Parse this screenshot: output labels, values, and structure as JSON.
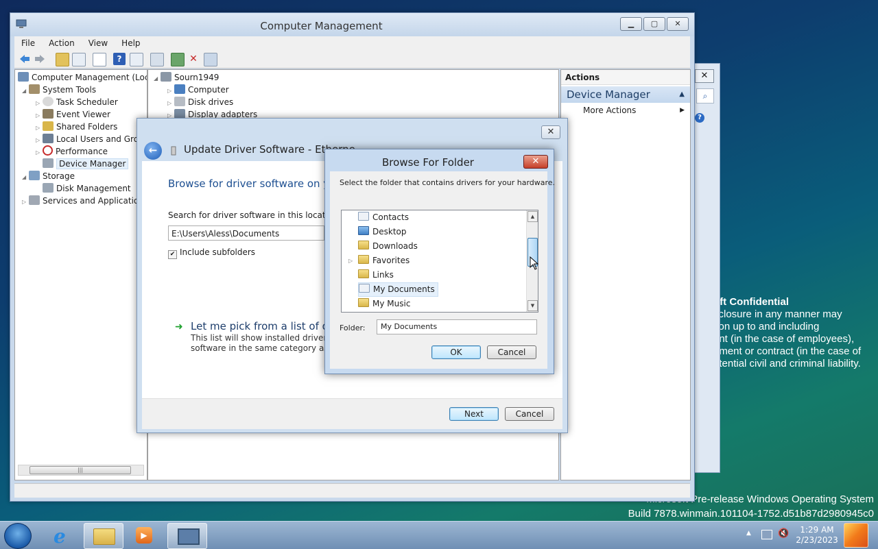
{
  "desktop": {
    "watermark_title": "oft Confidential",
    "watermark_lines": [
      "sclosure in any manner may",
      "tion up to and including",
      "ent (in the case of employees),",
      "nment or contract (in the case of",
      "otential civil and criminal liability."
    ],
    "build_line1": "Microsoft Pre-release Windows Operating System",
    "build_line2": "Build 7878.winmain.101104-1752.d51b87d2980945c0"
  },
  "main_window": {
    "title": "Computer Management",
    "menu": [
      "File",
      "Action",
      "View",
      "Help"
    ],
    "tree": [
      "Computer Management (Local",
      "System Tools",
      "Task Scheduler",
      "Event Viewer",
      "Shared Folders",
      "Local Users and Groups",
      "Performance",
      "Device Manager",
      "Storage",
      "Disk Management",
      "Services and Applications"
    ],
    "devices": {
      "root": "Sourn1949",
      "items": [
        "Computer",
        "Disk drives",
        "Display adapters"
      ]
    },
    "actions": {
      "header": "Actions",
      "section": "Device Manager",
      "item": "More Actions"
    }
  },
  "update_driver": {
    "title": "Update Driver Software - Ethernet Controller",
    "heading": "Browse for driver software on your computer",
    "search_label": "Search for driver software in this location:",
    "path_value": "E:\\Users\\Aless\\Documents",
    "include_subfolders": "Include subfolders",
    "pick_title": "Let me pick from a list of device drivers on my computer",
    "pick_desc1": "This list will show installed driver software compatible with the device, and all driver",
    "pick_desc2": "software in the same category as the device.",
    "next": "Next",
    "cancel": "Cancel"
  },
  "browse_folder": {
    "title": "Browse For Folder",
    "instruction": "Select the folder that contains drivers for your hardware.",
    "folders": [
      "Contacts",
      "Desktop",
      "Downloads",
      "Favorites",
      "Links",
      "My Documents",
      "My Music"
    ],
    "folder_label": "Folder:",
    "folder_value": "My Documents",
    "ok": "OK",
    "cancel": "Cancel"
  },
  "taskbar": {
    "time": "1:29 AM",
    "date": "2/23/2023"
  },
  "colors": {
    "accent": "#3c7fb1",
    "selection": "#e5f0fb"
  }
}
